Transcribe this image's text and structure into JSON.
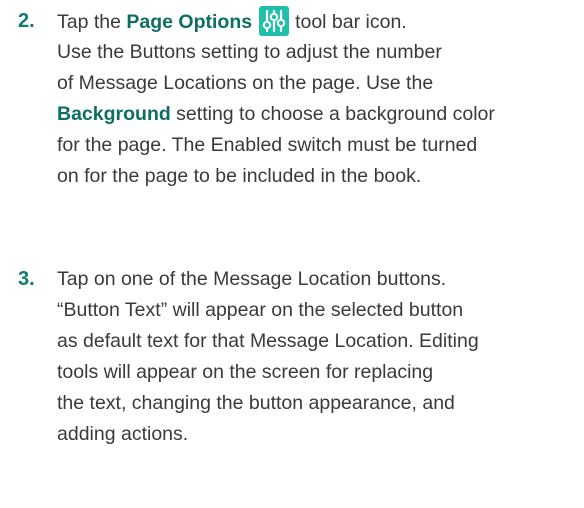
{
  "step2": {
    "number": "2.",
    "line1_before": "Tap the ",
    "line1_bold": "Page Options",
    "line1_icon": "page-options-sliders-icon",
    "line1_after": "tool bar icon.",
    "line2": "Use the Buttons setting to adjust the number",
    "line3": "of Message Locations on the page. Use the",
    "line4_bold": "Background",
    "line4_after": " setting to choose a background color",
    "line5": "for the page. The Enabled switch must be turned",
    "line6": "on for the page to be included in the book."
  },
  "step3": {
    "number": "3.",
    "lines": [
      "Tap on one of the Message Location buttons.",
      "“Button Text” will appear on the selected button",
      "as default text for that Message Location. Editing",
      "tools will appear on the screen for replacing",
      "the text, changing the button appearance, and",
      "adding actions."
    ]
  },
  "colors": {
    "accent": "#0f7a6e",
    "icon_bg": "#1fbfa9",
    "text": "#3a3a3a"
  }
}
